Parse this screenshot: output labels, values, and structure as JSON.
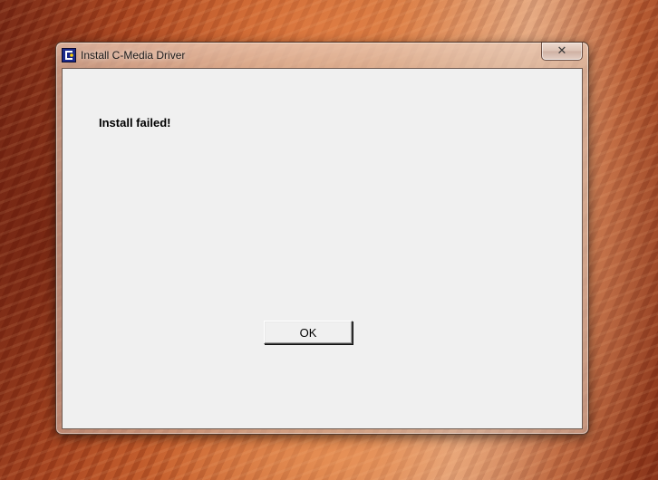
{
  "window": {
    "title": "Install C-Media Driver",
    "close_glyph": "✕"
  },
  "dialog": {
    "message": "Install failed!",
    "ok_label": "OK"
  },
  "icons": {
    "app_icon": "c-media-icon",
    "close_icon": "close-icon"
  },
  "colors": {
    "client_background": "#f0f0f0",
    "text": "#000000"
  }
}
